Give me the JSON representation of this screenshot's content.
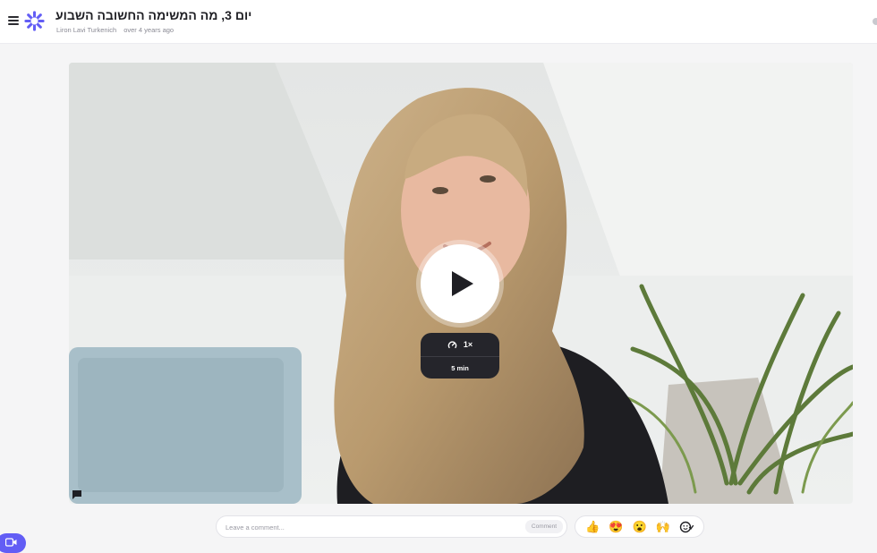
{
  "header": {
    "title": "יום 3, מה המשימה החשובה השבוע",
    "author": "Liron Lavi Turkenich",
    "timestamp": "over 4 years ago",
    "menu_icon": "hamburger-menu-icon",
    "logo_icon": "loom-logo-icon"
  },
  "player": {
    "play_icon": "play-icon",
    "speed_icon": "playback-speed-icon",
    "speed": "1×",
    "duration": "5 min",
    "captions_icon": "comment-bubble-icon"
  },
  "comment": {
    "placeholder": "Leave a comment...",
    "button_label": "Comment"
  },
  "reactions": {
    "items": [
      "👍",
      "😍",
      "😮",
      "🙌"
    ],
    "add_icon": "add-reaction-icon"
  },
  "record": {
    "icon": "video-camera-icon"
  },
  "colors": {
    "accent": "#625df5",
    "header_bg": "#ffffff",
    "page_bg": "#f5f5f6"
  }
}
